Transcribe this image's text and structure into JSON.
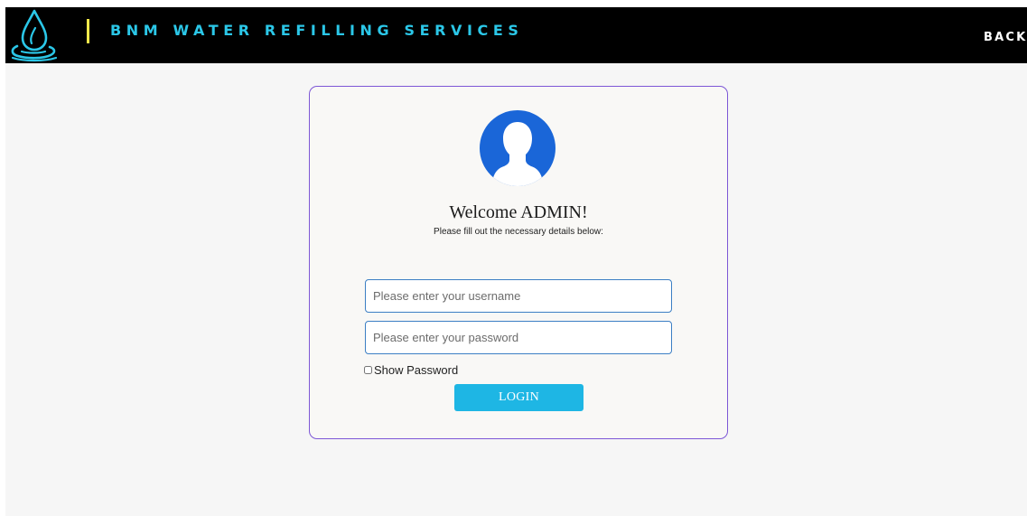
{
  "header": {
    "brand": "BNM WATER REFILLING SERVICES",
    "back_label": "BACK",
    "logo_icon": "water-drop-icon",
    "colors": {
      "bar": "#000000",
      "brand_text": "#2bc7e8",
      "divider": "#f2e84b"
    }
  },
  "login_card": {
    "avatar_icon": "user-avatar-icon",
    "title": "Welcome ADMIN!",
    "subtitle": "Please fill out the necessary details below:",
    "username": {
      "placeholder": "Please enter your username",
      "value": ""
    },
    "password": {
      "placeholder": "Please enter your password",
      "value": ""
    },
    "show_password_label": "Show Password",
    "show_password_checked": false,
    "login_label": "LOGIN",
    "colors": {
      "border": "#7d57d6",
      "avatar": "#1a66d8",
      "login_button": "#1eb6e4"
    }
  }
}
